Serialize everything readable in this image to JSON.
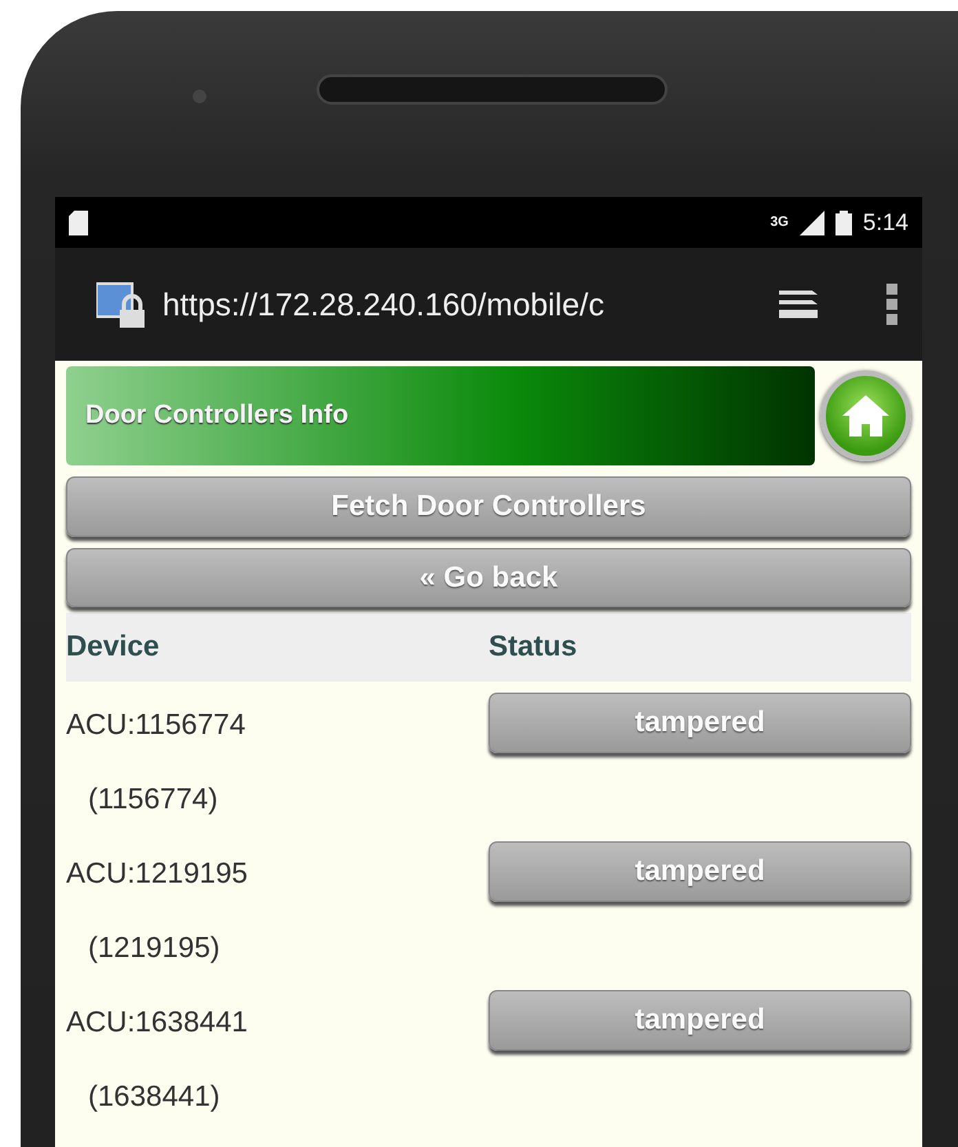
{
  "status_bar": {
    "signal_label": "3G",
    "time": "5:14"
  },
  "address_bar": {
    "url": "https://172.28.240.160/mobile/c"
  },
  "header": {
    "title": "Door Controllers Info"
  },
  "buttons": [
    {
      "label": "Fetch Door Controllers"
    },
    {
      "label": "« Go back"
    }
  ],
  "table": {
    "columns": [
      "Device",
      "Status"
    ],
    "rows": [
      {
        "device": "ACU:1156774",
        "device_id": "(1156774)",
        "status": "tampered"
      },
      {
        "device": "ACU:1219195",
        "device_id": "(1219195)",
        "status": "tampered"
      },
      {
        "device": "ACU:1638441",
        "device_id": "(1638441)",
        "status": "tampered"
      }
    ]
  }
}
